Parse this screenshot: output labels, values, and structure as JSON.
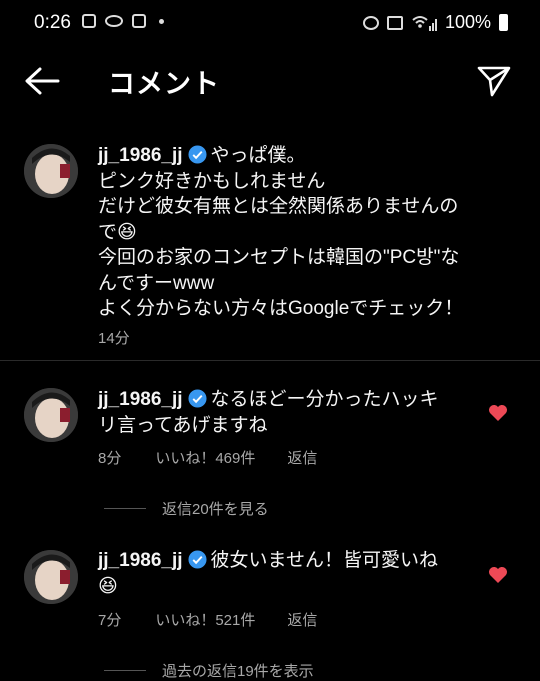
{
  "status_bar": {
    "time": "0:26",
    "battery": "100%"
  },
  "header": {
    "title": "コメント",
    "back_icon": "arrow-left-icon",
    "send_icon": "paper-plane-icon"
  },
  "caption": {
    "username": "jj_1986_jj",
    "lines": [
      "やっぱ僕。",
      "ピンク好きかもしれません",
      "だけど彼女有無とは全然関係ありませんの",
      "で😆",
      "今回のお家のコンセプトは韓国の\"PC방\"な",
      "んですーwww",
      "よく分からない方々はGoogleでチェック！"
    ],
    "time": "14分"
  },
  "replies": [
    {
      "username": "jj_1986_jj",
      "text_line1": "なるほどー分かったハッキ",
      "text_line2": "リ言ってあげますね",
      "time": "8分",
      "likes": "いいね！469件",
      "reply_label": "返信",
      "view_more": "返信20件を見る"
    },
    {
      "username": "jj_1986_jj",
      "text_line1": "彼女いません！皆可愛いね",
      "text_line2": "😆",
      "time": "7分",
      "likes": "いいね！521件",
      "reply_label": "返信",
      "view_more": "過去の返信19件を表示"
    }
  ],
  "colors": {
    "background": "#000000",
    "text": "#f5f5f5",
    "secondary": "#a8a8a8",
    "verified": "#3897f0",
    "heart": "#ed4956"
  }
}
